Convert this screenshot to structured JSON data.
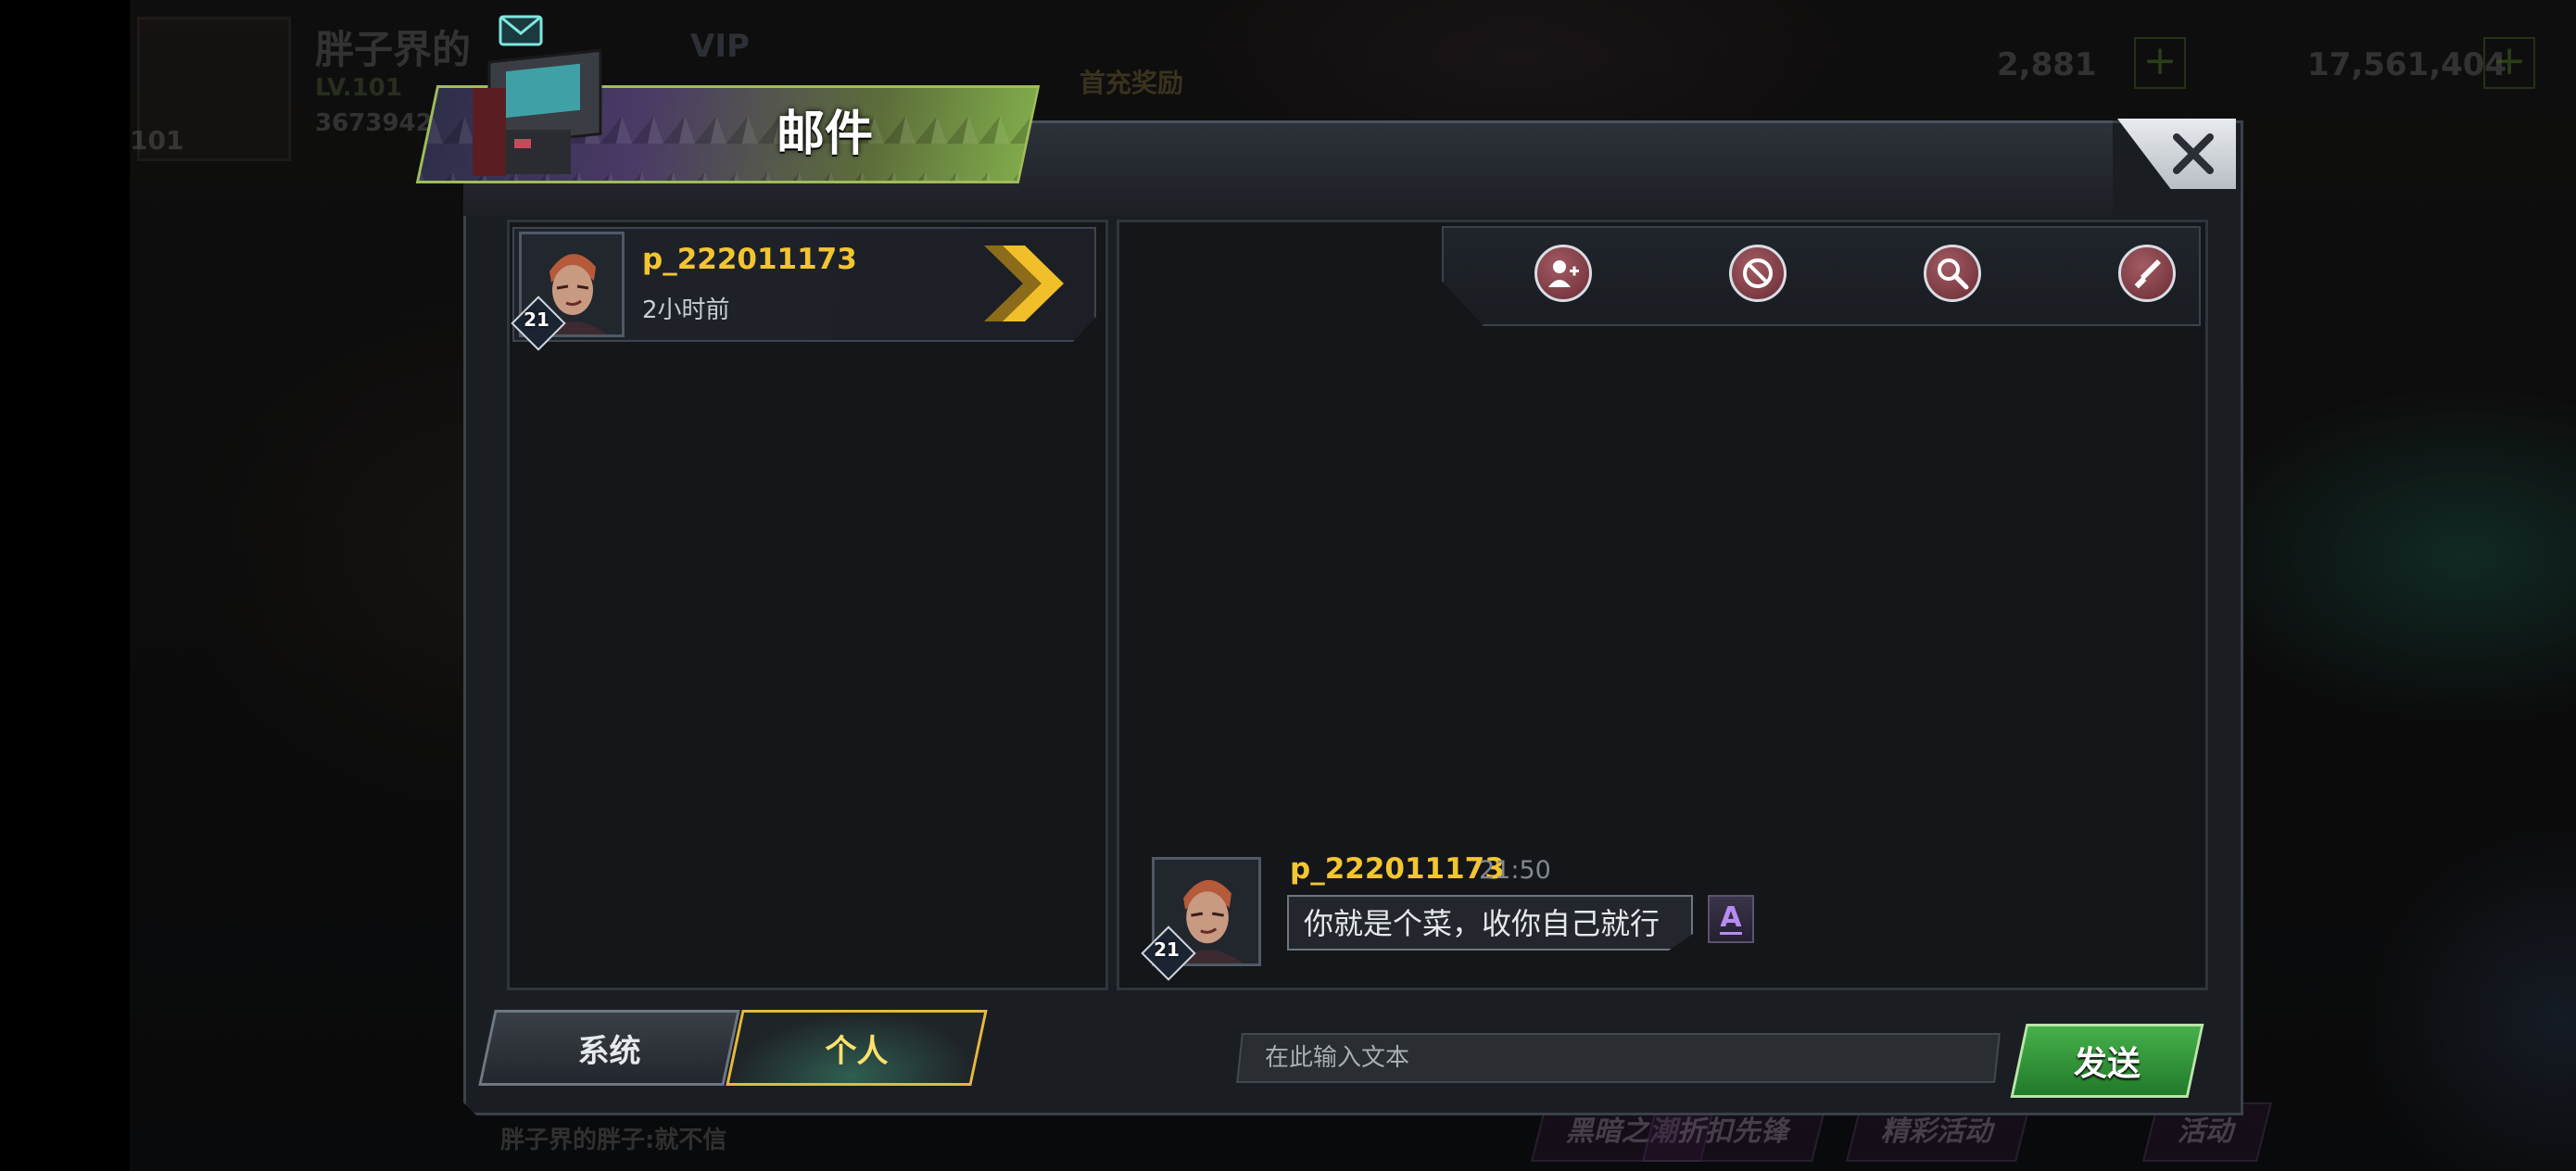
{
  "background_hud": {
    "player_name": "胖子界的",
    "player_level": "LV.101",
    "player_id": "3673942",
    "level_badge": "101",
    "vip": "VIP",
    "first_charge": "首充奖励",
    "currency_1": "2,881",
    "currency_2": "17,561,404",
    "chat_preview": "胖子界的胖子:就不信",
    "bottom_buttons": [
      "黑暗之潮",
      "折扣先锋",
      "精彩活动",
      "活动"
    ]
  },
  "dialog": {
    "title": "邮件",
    "close_label": "✕"
  },
  "mail_list": [
    {
      "sender": "p_222011173",
      "time_ago": "2小时前",
      "level": "21"
    }
  ],
  "toolbar": {
    "buttons": [
      "add-friend",
      "block",
      "search",
      "report"
    ]
  },
  "conversation": {
    "messages": [
      {
        "sender": "p_222011173",
        "time": "21:50",
        "text": "你就是个菜，收你自己就行",
        "level": "21",
        "translate_label": "A"
      }
    ]
  },
  "tabs": {
    "system": "系统",
    "personal": "个人",
    "active": "personal"
  },
  "composer": {
    "placeholder": "在此输入文本",
    "value": "",
    "send_label": "发送"
  },
  "colors": {
    "name_gold": "#f3c531",
    "accent_green": "#46b04a",
    "tab_active_border": "#e5b93a",
    "tool_button": "#8a3f49"
  }
}
